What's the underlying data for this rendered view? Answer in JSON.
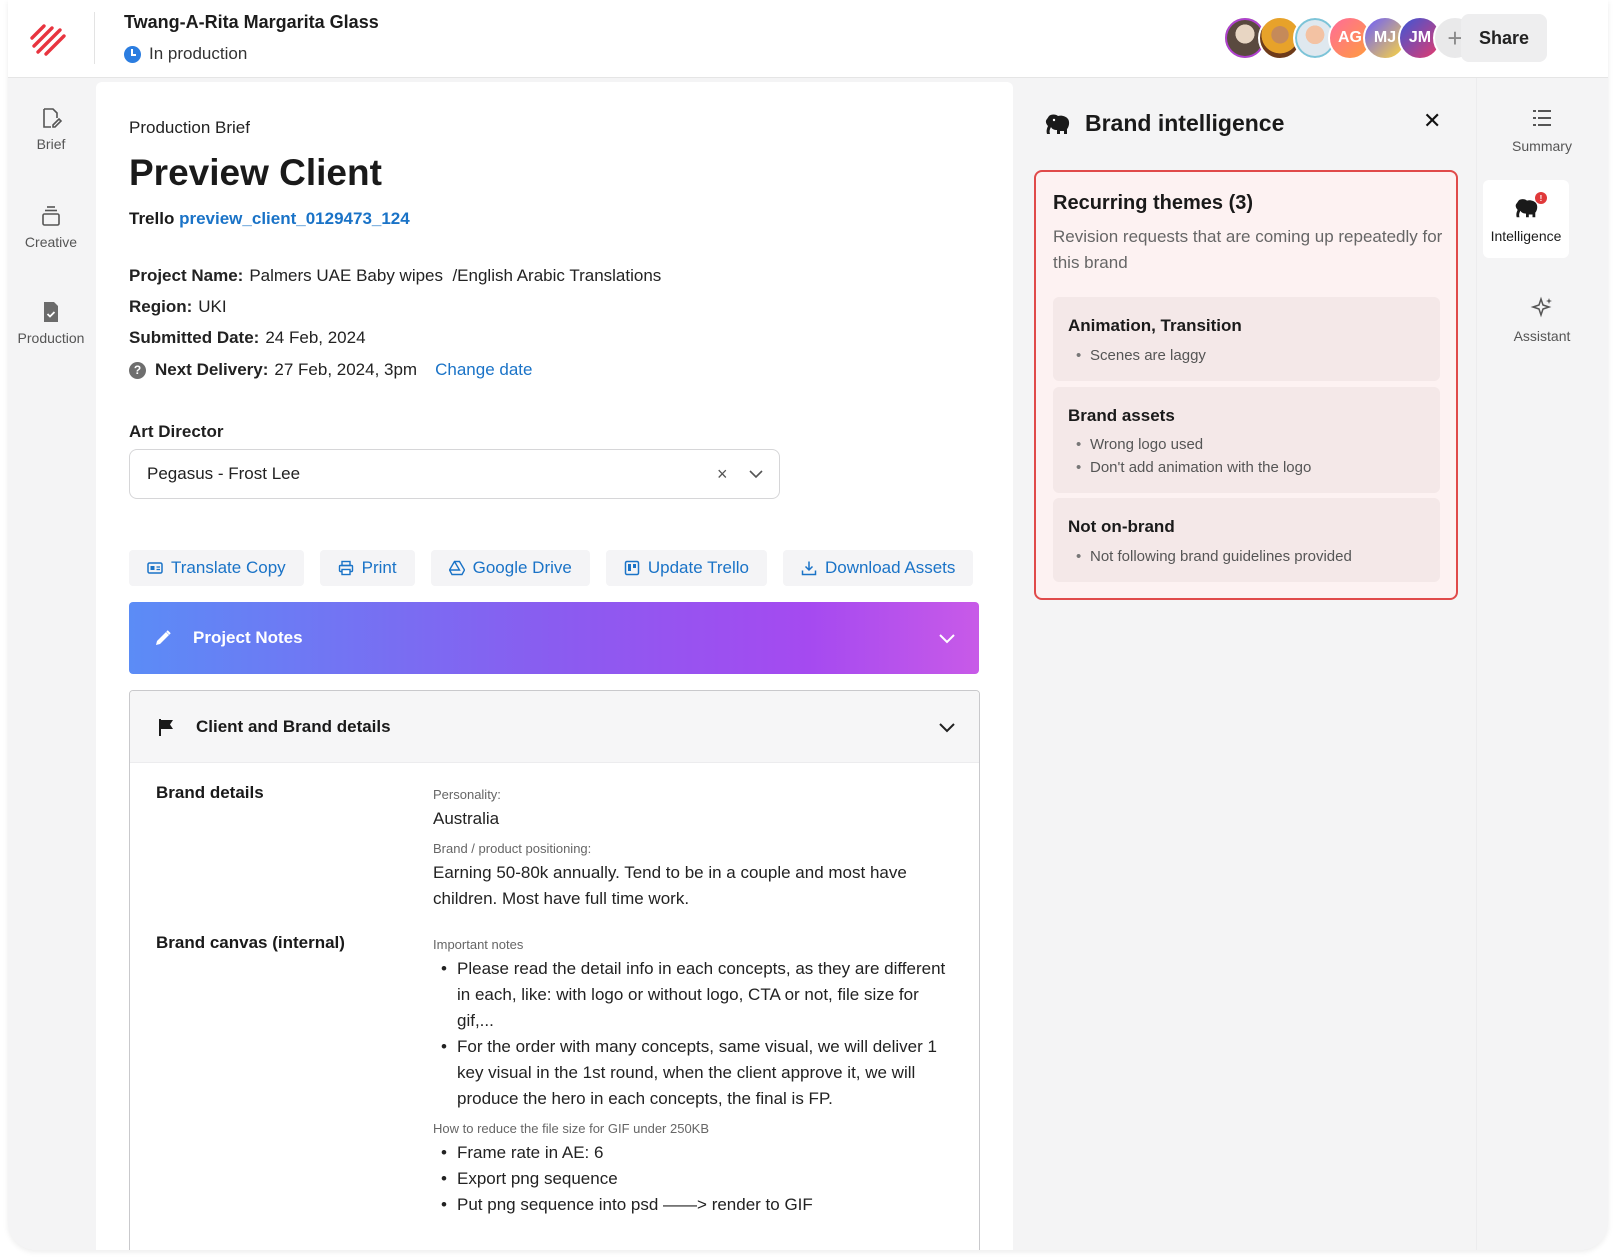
{
  "header": {
    "title": "Twang-A-Rita Margarita Glass",
    "status": "In production",
    "avatars": [
      {
        "type": "photo",
        "name": "person-1"
      },
      {
        "type": "photo",
        "name": "person-2"
      },
      {
        "type": "photo",
        "name": "person-3"
      },
      {
        "type": "initials",
        "initials": "AG"
      },
      {
        "type": "initials",
        "initials": "MJ"
      },
      {
        "type": "initials",
        "initials": "JM"
      }
    ],
    "add_symbol": "+",
    "share_label": "Share"
  },
  "left_rail": {
    "items": [
      {
        "label": "Brief",
        "icon": "file-edit-icon"
      },
      {
        "label": "Creative",
        "icon": "layers-icon"
      },
      {
        "label": "Production",
        "icon": "file-check-icon"
      }
    ]
  },
  "brief": {
    "eyebrow": "Production Brief",
    "title": "Preview Client",
    "trello_label": "Trello",
    "trello_link": "preview_client_0129473_124",
    "project_name_label": "Project Name:",
    "project_name_value": "Palmers UAE Baby wipes  /English Arabic Translations",
    "region_label": "Region:",
    "region_value": "UKI",
    "submitted_label": "Submitted Date:",
    "submitted_value": "24 Feb, 2024",
    "delivery_icon": "?",
    "delivery_label": "Next Delivery:",
    "delivery_value": "27 Feb, 2024, 3pm",
    "change_date": "Change date",
    "art_director_label": "Art Director",
    "art_director_value": "Pegasus - Frost Lee",
    "clear_symbol": "×",
    "actions": [
      {
        "label": "Translate Copy",
        "icon": "translate-icon"
      },
      {
        "label": "Print",
        "icon": "printer-icon"
      },
      {
        "label": "Google Drive",
        "icon": "drive-icon"
      },
      {
        "label": "Update Trello",
        "icon": "trello-icon"
      },
      {
        "label": "Download Assets",
        "icon": "download-icon"
      }
    ],
    "project_notes": "Project Notes",
    "client_brand_details": "Client and Brand details",
    "brand_details_label": "Brand details",
    "personality_label": "Personality:",
    "personality_value": "Australia",
    "positioning_label": "Brand / product positioning:",
    "positioning_value": "Earning 50-80k annually. Tend to be in a couple and most have children. Most have full time work.",
    "brand_canvas_label": "Brand canvas (internal)",
    "important_notes_label": "Important notes",
    "important_notes": [
      "Please read the detail info in each concepts, as they are different in each, like: with logo or without logo, CTA or not, file size for gif,...",
      "For the order with many concepts, same visual, we will deliver 1 key visual in the 1st round, when the client approve it, we will produce the hero in each concepts, the final is FP."
    ],
    "gif_label": "How to reduce the file size for GIF under 250KB",
    "gif_steps": [
      "Frame rate in AE: 6",
      "Export png sequence",
      "Put png sequence into psd ——> render to GIF"
    ]
  },
  "intelligence": {
    "title": "Brand intelligence",
    "close_symbol": "✕",
    "themes_title": "Recurring themes (3)",
    "themes_subtitle": "Revision requests that are coming up repeatedly for this brand",
    "cards": [
      {
        "title": "Animation, Transition",
        "items": [
          "Scenes are laggy"
        ]
      },
      {
        "title": "Brand assets",
        "items": [
          "Wrong logo used",
          "Don't add animation with the logo"
        ]
      },
      {
        "title": "Not on-brand",
        "items": [
          "Not following brand guidelines provided"
        ]
      }
    ]
  },
  "right_rail": {
    "items": [
      {
        "label": "Summary",
        "icon": "list-icon"
      },
      {
        "label": "Intelligence",
        "icon": "elephant-icon",
        "badge": "!"
      },
      {
        "label": "Assistant",
        "icon": "sparkle-icon"
      }
    ]
  },
  "colors": {
    "link": "#1a73c7",
    "accent_red": "#e04a4a",
    "status_blue": "#2b7de0"
  }
}
